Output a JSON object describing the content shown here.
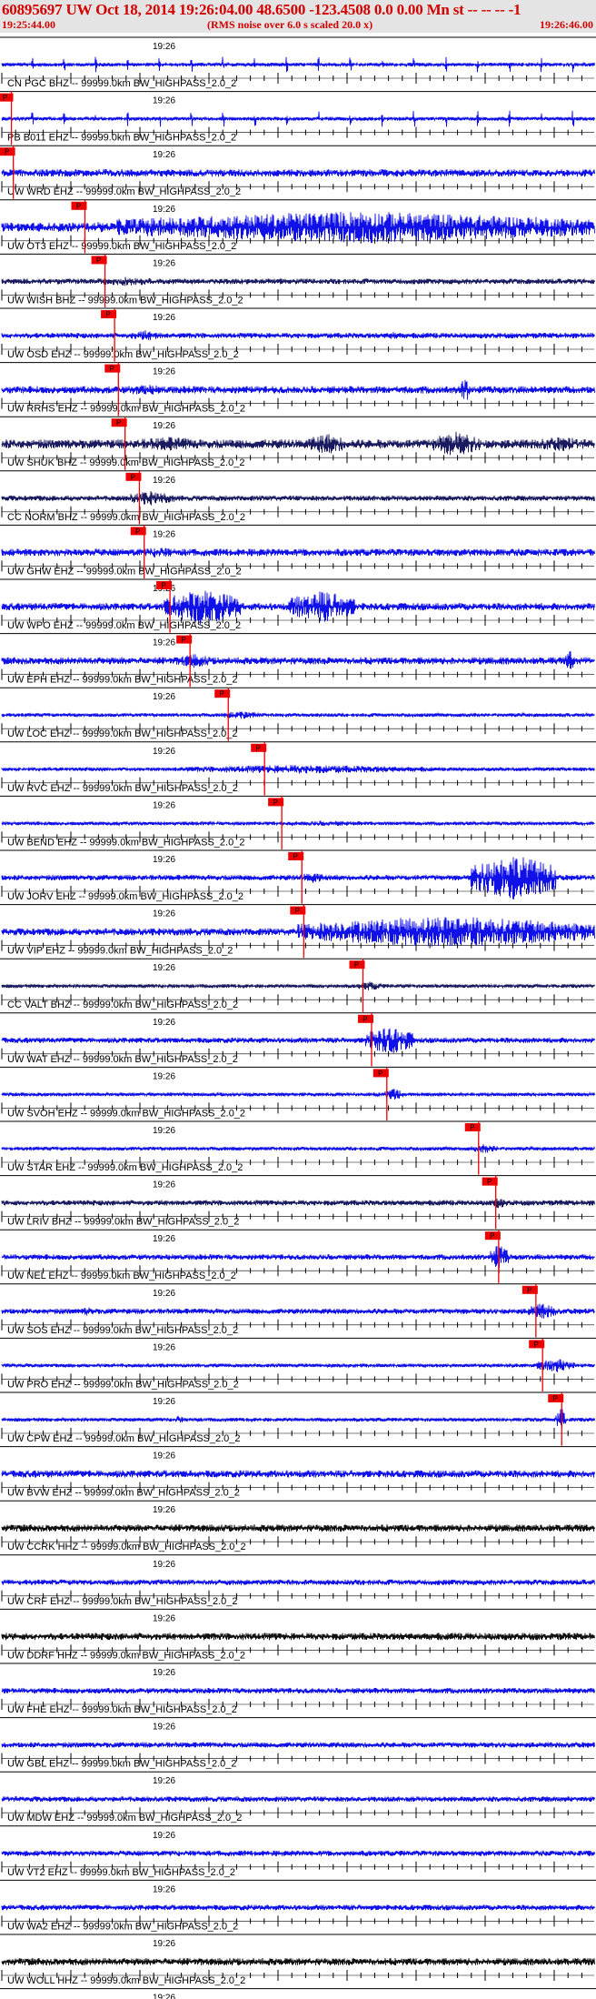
{
  "header": {
    "title": "60895697 UW Oct 18, 2014 19:26:04.00   48.6500 -123.4508  0.0 0.00 Mn st -- -- -- -1",
    "start_time": "19:25:44.00",
    "note": "(RMS noise over 6.0 s scaled 20.0 x)",
    "end_time": "19:26:46.00"
  },
  "tick_time_label": "19:26",
  "pick_label": "P",
  "colors": {
    "text": "#d40000",
    "blue": "#1010e8",
    "navy": "#1a1a60",
    "black": "#101010",
    "pick": "#ee0000",
    "header_bg": "#e4e4e4"
  },
  "chart_data": {
    "type": "line",
    "title": "",
    "xlabel": "",
    "ylabel": "",
    "x_range_seconds": [
      0,
      62
    ],
    "traces": [
      {
        "label": "CN PGC BHZ -- 99999.0km BW_HIGHPASS_2.0_2",
        "color": "blue",
        "pick": null,
        "amp": 2,
        "events": [
          [
            0,
            62,
            "spikes"
          ]
        ]
      },
      {
        "label": "PB B011 EHZ -- 99999.0km BW_HIGHPASS_2.0_2",
        "color": "blue",
        "pick": 1.0,
        "amp": 2,
        "events": [
          [
            0,
            62,
            "spikes"
          ]
        ]
      },
      {
        "label": "UW WRD EHZ -- 99999.0km BW_HIGHPASS_2.0_2",
        "color": "blue",
        "pick": 1.2,
        "amp": 4,
        "events": [
          [
            8,
            15,
            5
          ],
          [
            16,
            62,
            3
          ]
        ]
      },
      {
        "label": "UW OT3 EHZ -- 99999.0km BW_HIGHPASS_2.0_2",
        "color": "blue",
        "pick": 8.7,
        "amp": 5,
        "events": [
          [
            12,
            62,
            18
          ],
          [
            8,
            12,
            6
          ]
        ]
      },
      {
        "label": "UW WISH BHZ -- 99999.0km BW_HIGHPASS_2.0_2",
        "color": "navy",
        "pick": 10.8,
        "amp": 3,
        "events": [
          [
            9,
            17,
            5
          ],
          [
            17,
            29,
            2
          ]
        ]
      },
      {
        "label": "UW OSD EHZ -- 99999.0km BW_HIGHPASS_2.0_2",
        "color": "blue",
        "pick": 11.8,
        "amp": 3,
        "events": [
          [
            13,
            17,
            6
          ],
          [
            40,
            42,
            5
          ]
        ]
      },
      {
        "label": "UW RRHS EHZ -- 99999.0km BW_HIGHPASS_2.0_2",
        "color": "blue",
        "pick": 12.2,
        "amp": 4,
        "events": [
          [
            12,
            18,
            6
          ],
          [
            48,
            49,
            14
          ]
        ]
      },
      {
        "label": "UW SHUK BHZ -- 99999.0km BW_HIGHPASS_2.0_2",
        "color": "navy",
        "pick": 12.9,
        "amp": 5,
        "events": [
          [
            13,
            22,
            8
          ],
          [
            32,
            36,
            12
          ],
          [
            45,
            50,
            14
          ],
          [
            55,
            62,
            8
          ]
        ]
      },
      {
        "label": "CC NORM BHZ -- 99999.0km BW_HIGHPASS_2.0_2",
        "color": "navy",
        "pick": 14.4,
        "amp": 3,
        "events": [
          [
            13,
            18,
            8
          ]
        ]
      },
      {
        "label": "UW GHW EHZ -- 99999.0km BW_HIGHPASS_2.0_2",
        "color": "blue",
        "pick": 14.9,
        "amp": 4,
        "events": [
          [
            14,
            19,
            6
          ]
        ]
      },
      {
        "label": "UW WPO EHZ -- 99999.0km BW_HIGHPASS_2.0_2",
        "color": "blue",
        "pick": 17.6,
        "amp": 4,
        "events": [
          [
            17,
            25,
            20
          ],
          [
            30,
            37,
            18
          ]
        ]
      },
      {
        "label": "UW EPH EHZ -- 99999.0km BW_HIGHPASS_2.0_2",
        "color": "blue",
        "pick": 19.7,
        "amp": 4,
        "events": [
          [
            18,
            22,
            8
          ],
          [
            59,
            60,
            12
          ]
        ]
      },
      {
        "label": "UW LOC EHZ -- 99999.0km BW_HIGHPASS_2.0_2",
        "color": "blue",
        "pick": 23.7,
        "amp": 2,
        "events": [
          [
            23,
            27,
            5
          ]
        ]
      },
      {
        "label": "UW RVC EHZ -- 99999.0km BW_HIGHPASS_2.0_2",
        "color": "blue",
        "pick": 27.5,
        "amp": 2,
        "events": [
          [
            18,
            45,
            5
          ]
        ]
      },
      {
        "label": "UW BEND EHZ -- 99999.0km BW_HIGHPASS_2.0_2",
        "color": "blue",
        "pick": 29.3,
        "amp": 2,
        "events": [
          [
            28,
            40,
            3
          ]
        ]
      },
      {
        "label": "UW JORV EHZ -- 99999.0km BW_HIGHPASS_2.0_2",
        "color": "blue",
        "pick": 31.4,
        "amp": 3,
        "events": [
          [
            31,
            34,
            6
          ],
          [
            49,
            58,
            26
          ]
        ]
      },
      {
        "label": "UW VIP EHZ -- 99999.0km BW_HIGHPASS_2.0_2",
        "color": "blue",
        "pick": 31.6,
        "amp": 4,
        "events": [
          [
            31,
            62,
            18
          ]
        ]
      },
      {
        "label": "CC VALT BHZ -- 99999.0km BW_HIGHPASS_2.0_2",
        "color": "navy",
        "pick": 37.8,
        "amp": 2,
        "events": [
          [
            37,
            40,
            5
          ]
        ]
      },
      {
        "label": "UW WAT EHZ -- 99999.0km BW_HIGHPASS_2.0_2",
        "color": "blue",
        "pick": 38.7,
        "amp": 3,
        "events": [
          [
            38,
            43,
            16
          ]
        ]
      },
      {
        "label": "UW SVOH EHZ -- 99999.0km BW_HIGHPASS_2.0_2",
        "color": "blue",
        "pick": 40.3,
        "amp": 2,
        "events": [
          [
            40,
            42,
            7
          ]
        ]
      },
      {
        "label": "UW STAR EHZ -- 99999.0km BW_HIGHPASS_2.0_2",
        "color": "blue",
        "pick": 49.9,
        "amp": 2,
        "events": [
          [
            49,
            52,
            5
          ]
        ]
      },
      {
        "label": "UW LRIV BHZ -- 99999.0km BW_HIGHPASS_2.0_2",
        "color": "navy",
        "pick": 51.7,
        "amp": 3,
        "events": [
          [
            51,
            53,
            6
          ]
        ]
      },
      {
        "label": "UW NEL EHZ -- 99999.0km BW_HIGHPASS_2.0_2",
        "color": "blue",
        "pick": 52.0,
        "amp": 3,
        "events": [
          [
            51,
            53,
            14
          ]
        ]
      },
      {
        "label": "UW SOS EHZ -- 99999.0km BW_HIGHPASS_2.0_2",
        "color": "blue",
        "pick": 55.9,
        "amp": 3,
        "events": [
          [
            55,
            58,
            9
          ],
          [
            8,
            10,
            5
          ]
        ]
      },
      {
        "label": "UW PRO EHZ -- 99999.0km BW_HIGHPASS_2.0_2",
        "color": "blue",
        "pick": 56.6,
        "amp": 2,
        "events": [
          [
            56,
            60,
            8
          ]
        ]
      },
      {
        "label": "UW CPW EHZ -- 99999.0km BW_HIGHPASS_2.0_2",
        "color": "blue",
        "pick": 58.6,
        "amp": 2,
        "events": [
          [
            58,
            59,
            14
          ],
          [
            18,
            19,
            5
          ]
        ]
      },
      {
        "label": "UW BVW EHZ -- 99999.0km BW_HIGHPASS_2.0_2",
        "color": "blue",
        "pick": null,
        "amp": 4,
        "events": []
      },
      {
        "label": "UW CCRK HHZ -- 99999.0km BW_HIGHPASS_2.0_2",
        "color": "black",
        "pick": null,
        "amp": 4,
        "events": []
      },
      {
        "label": "UW CRF EHZ -- 99999.0km BW_HIGHPASS_2.0_2",
        "color": "blue",
        "pick": null,
        "amp": 3,
        "events": []
      },
      {
        "label": "UW DDRF HHZ -- 99999.0km BW_HIGHPASS_2.0_2",
        "color": "black",
        "pick": null,
        "amp": 4,
        "events": []
      },
      {
        "label": "UW FHE EHZ -- 99999.0km BW_HIGHPASS_2.0_2",
        "color": "blue",
        "pick": null,
        "amp": 3,
        "events": []
      },
      {
        "label": "UW GBL EHZ -- 99999.0km BW_HIGHPASS_2.0_2",
        "color": "blue",
        "pick": null,
        "amp": 3,
        "events": []
      },
      {
        "label": "UW MDW EHZ -- 99999.0km BW_HIGHPASS_2.0_2",
        "color": "blue",
        "pick": null,
        "amp": 3,
        "events": []
      },
      {
        "label": "UW VT2 EHZ -- 99999.0km BW_HIGHPASS_2.0_2",
        "color": "blue",
        "pick": null,
        "amp": 3,
        "events": []
      },
      {
        "label": "UW WA2 EHZ -- 99999.0km BW_HIGHPASS_2.0_2",
        "color": "blue",
        "pick": null,
        "amp": 3,
        "events": []
      },
      {
        "label": "UW WOLL HHZ -- 99999.0km BW_HIGHPASS_2.0_2",
        "color": "black",
        "pick": null,
        "amp": 4,
        "events": []
      },
      {
        "label": "",
        "color": "black",
        "pick": null,
        "amp": 4,
        "events": []
      }
    ]
  }
}
